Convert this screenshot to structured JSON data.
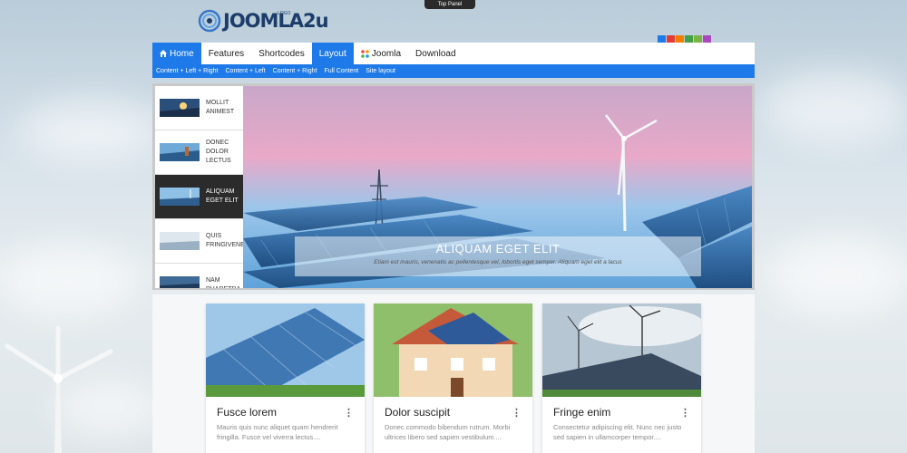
{
  "top_panel": "Top Panel",
  "logo": {
    "text": "JOOMLA2u",
    "sub": "LOGO"
  },
  "swatches": [
    "#1e7ae8",
    "#e53935",
    "#f57c00",
    "#43a047",
    "#7cb342",
    "#ab47bc"
  ],
  "nav": {
    "items": [
      {
        "label": "Home",
        "icon": "home-icon"
      },
      {
        "label": "Features"
      },
      {
        "label": "Shortcodes"
      },
      {
        "label": "Layout"
      },
      {
        "label": "Joomla",
        "icon": "joomla-icon"
      },
      {
        "label": "Download"
      }
    ]
  },
  "subnav": {
    "items": [
      "Content + Left + Right",
      "Content + Left",
      "Content + Right",
      "Full Content",
      "Site layout"
    ]
  },
  "slider": {
    "thumbs": [
      {
        "label": "MOLLIT ANIMEST"
      },
      {
        "label": "DONEC DOLOR LECTUS"
      },
      {
        "label": "ALIQUAM EGET ELIT"
      },
      {
        "label": "QUIS FRINGIVENE"
      },
      {
        "label": "NAM PHARETRA"
      }
    ],
    "caption_title": "ALIQUAM EGET ELIT",
    "caption_text": "Etiam est mauris, venenatis ac pellentesque vel, lobortis eget semper. Aliquam eget elit a lacus"
  },
  "cards": [
    {
      "title": "Fusce lorem",
      "text": "Mauris quis nunc aliquet quam hendrerit fringilla. Fusce vel viverra lectus...."
    },
    {
      "title": "Dolor suscipit",
      "text": "Donec commodo bibendum rutrum. Morbi ultrices libero sed sapien vestibulum...."
    },
    {
      "title": "Fringe enim",
      "text": "Consectetur adipiscing elit. Nunc nec justo sed sapien in ullamcorper tempor...."
    }
  ]
}
